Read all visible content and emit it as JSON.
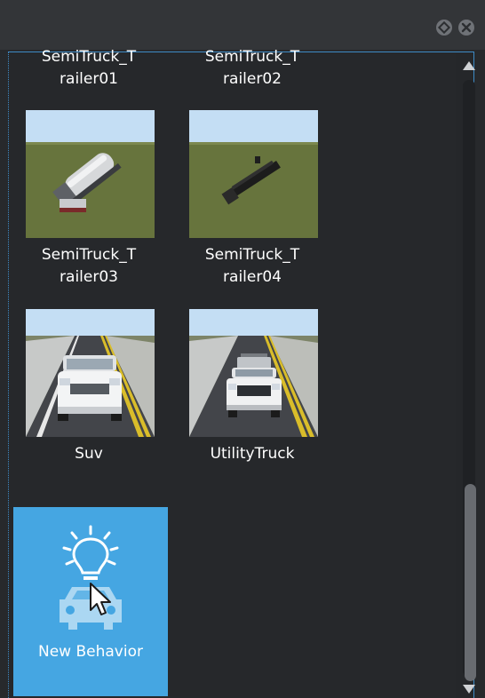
{
  "window": {
    "buttons": [
      "restore-icon",
      "close-icon"
    ]
  },
  "assets": {
    "items": [
      {
        "label": "SemiTruck_T\nrailer01"
      },
      {
        "label": "SemiTruck_T\nrailer02"
      },
      {
        "label": "SemiTruck_T\nrailer03"
      },
      {
        "label": "SemiTruck_T\nrailer04"
      },
      {
        "label": "Suv"
      },
      {
        "label": "UtilityTruck"
      }
    ],
    "new_behavior": {
      "label": "New Behavior"
    }
  },
  "colors": {
    "accent": "#45a6e2",
    "panel_border": "#3e8bc6",
    "background": "#26282b"
  }
}
